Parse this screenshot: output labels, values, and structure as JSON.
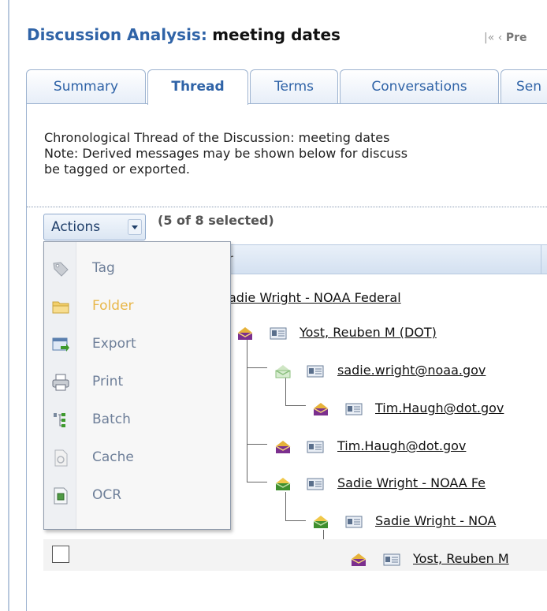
{
  "header": {
    "title_prefix": "Discussion Analysis:",
    "title_topic": "meeting dates",
    "pager_text": "Pre"
  },
  "tabs": [
    {
      "label": "Summary",
      "active": false
    },
    {
      "label": "Thread",
      "active": true
    },
    {
      "label": "Terms",
      "active": false
    },
    {
      "label": "Conversations",
      "active": false
    },
    {
      "label": "Sen",
      "active": false
    }
  ],
  "description": {
    "line1": "Chronological Thread of the Discussion: meeting dates",
    "line2": "Note: Derived messages may be shown below for discuss",
    "line3": "be tagged or exported."
  },
  "toolbar": {
    "actions_label": "Actions",
    "selection_status": "(5 of 8 selected)"
  },
  "grid": {
    "column_header": "r"
  },
  "actions_menu": [
    {
      "label": "Tag",
      "icon": "tag-icon",
      "highlighted": false
    },
    {
      "label": "Folder",
      "icon": "folder-icon",
      "highlighted": true
    },
    {
      "label": "Export",
      "icon": "export-icon",
      "highlighted": false
    },
    {
      "label": "Print",
      "icon": "print-icon",
      "highlighted": false
    },
    {
      "label": "Batch",
      "icon": "batch-icon",
      "highlighted": false
    },
    {
      "label": "Cache",
      "icon": "cache-icon",
      "highlighted": false
    },
    {
      "label": "OCR",
      "icon": "ocr-icon",
      "highlighted": false
    }
  ],
  "thread": [
    {
      "sender": "adie Wright - NOAA Federal",
      "level": 0,
      "envelope": "none"
    },
    {
      "sender": "Yost, Reuben M (DOT)",
      "level": 1,
      "envelope": "purple"
    },
    {
      "sender": "sadie.wright@noaa.gov",
      "level": 2,
      "envelope": "green"
    },
    {
      "sender": "Tim.Haugh@dot.gov",
      "level": 3,
      "envelope": "purple"
    },
    {
      "sender": "Tim.Haugh@dot.gov",
      "level": 2,
      "envelope": "purple"
    },
    {
      "sender": "Sadie Wright - NOAA Fe",
      "level": 2,
      "envelope": "green"
    },
    {
      "sender": "Sadie Wright - NOA",
      "level": 3,
      "envelope": "green"
    },
    {
      "sender": "Yost, Reuben M",
      "level": 4,
      "envelope": "purple"
    }
  ],
  "colors": {
    "accent_blue": "#2f63a7",
    "highlight_orange": "#e8b74a",
    "envelope_purple": "#7b2f8e",
    "envelope_green": "#3f8f2f"
  }
}
